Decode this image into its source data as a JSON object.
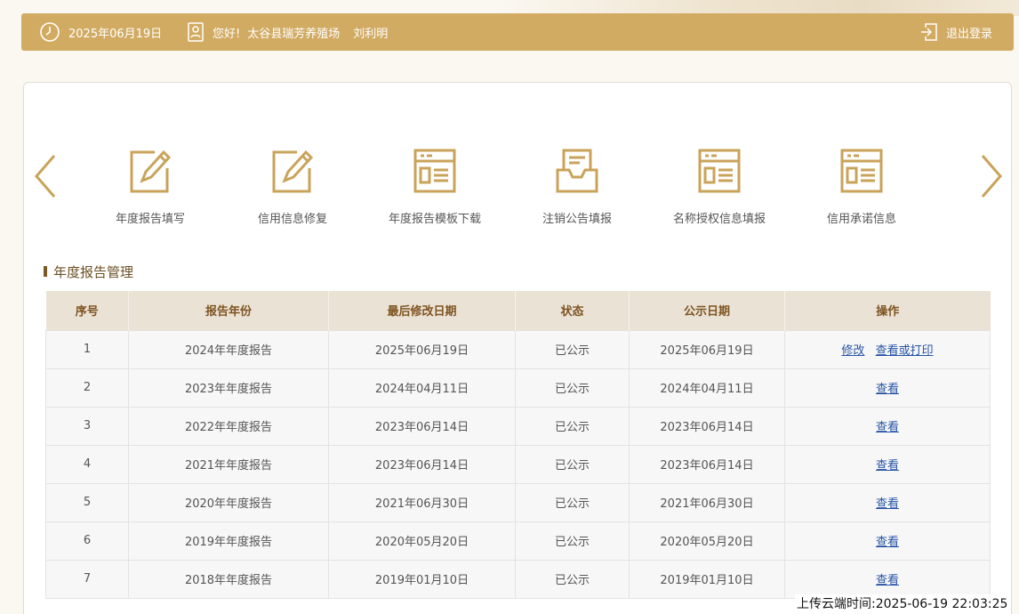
{
  "header": {
    "date": "2025年06月19日",
    "greeting": "您好!",
    "company": "太谷县瑞芳养殖场",
    "person": "刘利明",
    "logout": "退出登录"
  },
  "colors": {
    "header_bg": "#d2ab63",
    "icon_gold": "#c9a35a",
    "link_blue": "#2754a6",
    "table_head_bg": "#ebe2d6",
    "table_head_text": "#7d5420"
  },
  "nav": {
    "items": [
      {
        "label": "年度报告填写",
        "icon": "edit-icon"
      },
      {
        "label": "信用信息修复",
        "icon": "edit-icon"
      },
      {
        "label": "年度报告模板下载",
        "icon": "document-icon"
      },
      {
        "label": "注销公告填报",
        "icon": "inbox-icon"
      },
      {
        "label": "名称授权信息填报",
        "icon": "document-icon"
      },
      {
        "label": "信用承诺信息",
        "icon": "document-icon"
      }
    ]
  },
  "section": {
    "title": "年度报告管理"
  },
  "table": {
    "headers": [
      "序号",
      "报告年份",
      "最后修改日期",
      "状态",
      "公示日期",
      "操作"
    ],
    "rows": [
      {
        "index": "1",
        "year": "2024年年度报告",
        "modified": "2025年06月19日",
        "status": "已公示",
        "published": "2025年06月19日",
        "actions": [
          "修改",
          "查看或打印"
        ]
      },
      {
        "index": "2",
        "year": "2023年年度报告",
        "modified": "2024年04月11日",
        "status": "已公示",
        "published": "2024年04月11日",
        "actions": [
          "查看"
        ]
      },
      {
        "index": "3",
        "year": "2022年年度报告",
        "modified": "2023年06月14日",
        "status": "已公示",
        "published": "2023年06月14日",
        "actions": [
          "查看"
        ]
      },
      {
        "index": "4",
        "year": "2021年年度报告",
        "modified": "2023年06月14日",
        "status": "已公示",
        "published": "2023年06月14日",
        "actions": [
          "查看"
        ]
      },
      {
        "index": "5",
        "year": "2020年年度报告",
        "modified": "2021年06月30日",
        "status": "已公示",
        "published": "2021年06月30日",
        "actions": [
          "查看"
        ]
      },
      {
        "index": "6",
        "year": "2019年年度报告",
        "modified": "2020年05月20日",
        "status": "已公示",
        "published": "2020年05月20日",
        "actions": [
          "查看"
        ]
      },
      {
        "index": "7",
        "year": "2018年年度报告",
        "modified": "2019年01月10日",
        "status": "已公示",
        "published": "2019年01月10日",
        "actions": [
          "查看"
        ]
      }
    ]
  },
  "footer": {
    "upload_time": "上传云端时间:2025-06-19 22:03:25"
  }
}
